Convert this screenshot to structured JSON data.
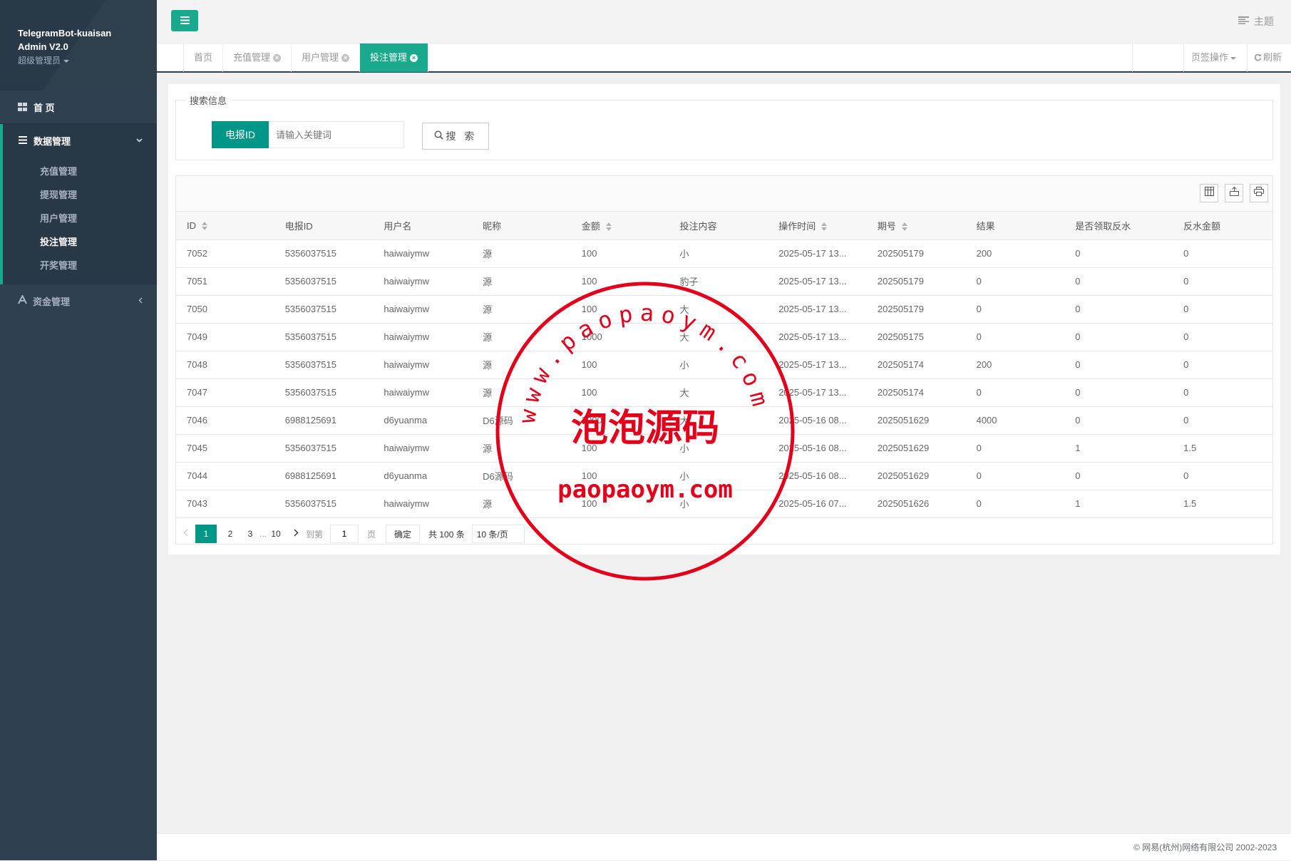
{
  "app": {
    "title_line1": "TelegramBot-kuaisan",
    "title_line2": "Admin V2.0",
    "role": "超级管理员"
  },
  "sidebar": {
    "home": "首 页",
    "data_group": "数据管理",
    "data_items": [
      "充值管理",
      "提现管理",
      "用户管理",
      "投注管理",
      "开奖管理"
    ],
    "active_item": "投注管理",
    "funds_group": "资金管理"
  },
  "topbar": {
    "theme": "主题"
  },
  "tabs": [
    {
      "label": "首页",
      "closable": false,
      "active": false
    },
    {
      "label": "充值管理",
      "closable": true,
      "active": false
    },
    {
      "label": "用户管理",
      "closable": true,
      "active": false
    },
    {
      "label": "投注管理",
      "closable": true,
      "active": true
    }
  ],
  "tab_actions": {
    "page_ops": "页签操作",
    "refresh": "刷新"
  },
  "search": {
    "legend": "搜索信息",
    "field_label": "电报ID",
    "placeholder": "请输入关键词",
    "value": "",
    "button": "搜 索"
  },
  "table": {
    "columns": [
      "ID",
      "电报ID",
      "用户名",
      "昵称",
      "金额",
      "投注内容",
      "操作时间",
      "期号",
      "结果",
      "是否领取反水",
      "反水金额"
    ],
    "sortable": [
      "ID",
      "金额",
      "操作时间",
      "期号"
    ],
    "rows": [
      [
        "7052",
        "5356037515",
        "haiwaiymw",
        "源",
        "100",
        "小",
        "2025-05-17 13...",
        "202505179",
        "200",
        "0",
        "0"
      ],
      [
        "7051",
        "5356037515",
        "haiwaiymw",
        "源",
        "100",
        "豹子",
        "2025-05-17 13...",
        "202505179",
        "0",
        "0",
        "0"
      ],
      [
        "7050",
        "5356037515",
        "haiwaiymw",
        "源",
        "100",
        "大",
        "2025-05-17 13...",
        "202505179",
        "0",
        "0",
        "0"
      ],
      [
        "7049",
        "5356037515",
        "haiwaiymw",
        "源",
        "1000",
        "大",
        "2025-05-17 13...",
        "202505175",
        "0",
        "0",
        "0"
      ],
      [
        "7048",
        "5356037515",
        "haiwaiymw",
        "源",
        "100",
        "小",
        "2025-05-17 13...",
        "202505174",
        "200",
        "0",
        "0"
      ],
      [
        "7047",
        "5356037515",
        "haiwaiymw",
        "源",
        "100",
        "大",
        "2025-05-17 13...",
        "202505174",
        "0",
        "0",
        "0"
      ],
      [
        "7046",
        "6988125691",
        "d6yuanma",
        "D6源码",
        "2000",
        "大",
        "2025-05-16 08...",
        "2025051629",
        "4000",
        "0",
        "0"
      ],
      [
        "7045",
        "5356037515",
        "haiwaiymw",
        "源",
        "100",
        "小",
        "2025-05-16 08...",
        "2025051629",
        "0",
        "1",
        "1.5"
      ],
      [
        "7044",
        "6988125691",
        "d6yuanma",
        "D6源码",
        "100",
        "小",
        "2025-05-16 08...",
        "2025051629",
        "0",
        "0",
        "0"
      ],
      [
        "7043",
        "5356037515",
        "haiwaiymw",
        "源",
        "100",
        "小",
        "2025-05-16 07...",
        "2025051626",
        "0",
        "1",
        "1.5"
      ]
    ]
  },
  "pager": {
    "pages": [
      "1",
      "2",
      "3",
      "...",
      "10"
    ],
    "current": "1",
    "goto_label": "到第",
    "goto_value": "1",
    "page_unit": "页",
    "confirm": "确定",
    "total": "共 100 条",
    "limit": "10 条/页"
  },
  "watermark": {
    "ring_text": "www.paopaoym.com",
    "center_text": "泡泡源码",
    "bottom_text": "paopaoym.com",
    "color": "#e3001b"
  },
  "footer": {
    "copyright": "© 网易(杭州)网络有限公司 2002-2023"
  },
  "colors": {
    "primary": "#009688",
    "accent": "#19aa8d",
    "sidebar": "#2f4050"
  }
}
